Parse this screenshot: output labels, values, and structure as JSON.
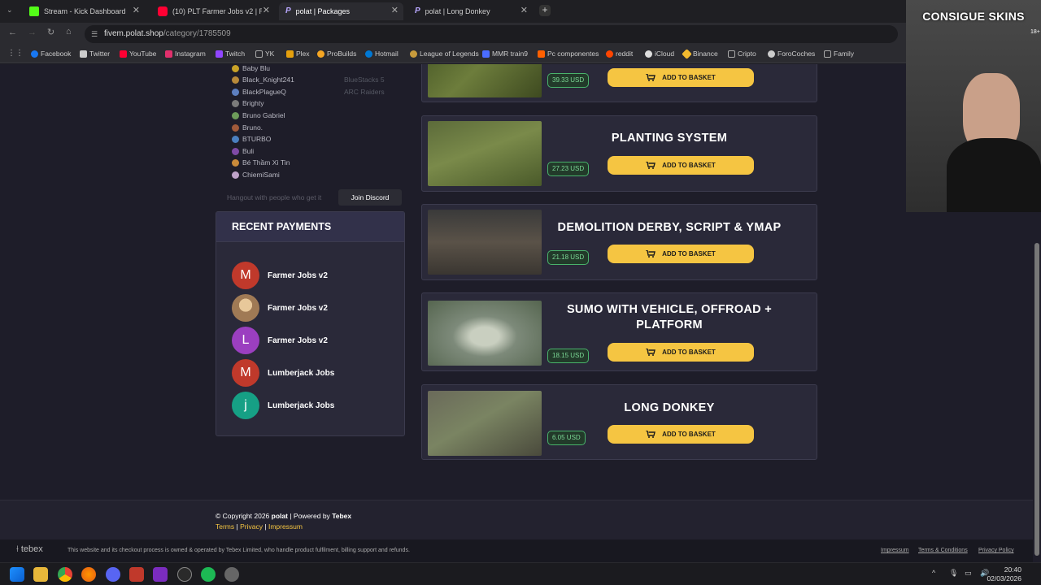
{
  "browser": {
    "tabs": [
      {
        "label": "Stream - Kick Dashboard",
        "color": "#53fc18"
      },
      {
        "label": "(10) PLT Farmer Jobs v2 | Realis",
        "color": "#ff0033"
      },
      {
        "label": "polat | Packages",
        "color": "#7b61ff"
      },
      {
        "label": "polat | Long Donkey",
        "color": "#7b61ff"
      }
    ],
    "url_host": "fivem.polat.shop",
    "url_path": "/category/1785509",
    "bookmarks": [
      {
        "label": "Facebook",
        "color": "#1877f2"
      },
      {
        "label": "Twitter",
        "color": "#cccccc"
      },
      {
        "label": "YouTube",
        "color": "#ff0033"
      },
      {
        "label": "Instagram",
        "color": "#e1306c"
      },
      {
        "label": "Twitch",
        "color": "#9146ff"
      },
      {
        "label": "YK",
        "color": "#888888"
      },
      {
        "label": "Plex",
        "color": "#e5a00d"
      },
      {
        "label": "ProBuilds",
        "color": "#f5a623"
      },
      {
        "label": "Hotmail",
        "color": "#0078d4"
      },
      {
        "label": "League of Legends",
        "color": "#c89b3c"
      },
      {
        "label": "MMR train9",
        "color": "#4a6cff"
      },
      {
        "label": "Pc componentes",
        "color": "#ff6000"
      },
      {
        "label": "reddit",
        "color": "#ff4500"
      },
      {
        "label": "iCloud",
        "color": "#dddddd"
      },
      {
        "label": "Binance",
        "color": "#f3ba2f"
      },
      {
        "label": "Cripto",
        "color": "#888888"
      },
      {
        "label": "ForoCoches",
        "color": "#cccccc"
      },
      {
        "label": "Family",
        "color": "#888888"
      }
    ]
  },
  "discord": {
    "members": [
      {
        "name": "Baby Blu",
        "game": ""
      },
      {
        "name": "Black_Knight241",
        "game": "BlueStacks 5"
      },
      {
        "name": "BlackPlagueQ",
        "game": "ARC Raiders"
      },
      {
        "name": "Brighty",
        "game": ""
      },
      {
        "name": "Bruno Gabriel",
        "game": ""
      },
      {
        "name": "Bruno.",
        "game": ""
      },
      {
        "name": "BTURBO",
        "game": ""
      },
      {
        "name": "Buli",
        "game": ""
      },
      {
        "name": "Bé Thầm Xì Tin",
        "game": ""
      },
      {
        "name": "ChiemiSami",
        "game": ""
      }
    ],
    "footer_text": "Hangout with people who get it",
    "join_label": "Join Discord"
  },
  "recent_payments": {
    "title": "RECENT PAYMENTS",
    "items": [
      {
        "initial": "M",
        "name": "Farmer Jobs v2",
        "color": "#c0392b"
      },
      {
        "initial": "",
        "name": "Farmer Jobs v2",
        "color": "#a07a55"
      },
      {
        "initial": "L",
        "name": "Farmer Jobs v2",
        "color": "#9b3fc0"
      },
      {
        "initial": "M",
        "name": "Lumberjack Jobs",
        "color": "#c0392b"
      },
      {
        "initial": "j",
        "name": "Lumberjack Jobs",
        "color": "#16a085"
      }
    ]
  },
  "packages": [
    {
      "title": "",
      "price": "39.33 USD",
      "button": "ADD TO BASKET"
    },
    {
      "title": "PLANTING SYSTEM",
      "price": "27.23 USD",
      "button": "ADD TO BASKET"
    },
    {
      "title": "DEMOLITION DERBY, SCRIPT & YMAP",
      "price": "21.18 USD",
      "button": "ADD TO BASKET"
    },
    {
      "title": "SUMO WITH VEHICLE, OFFROAD + PLATFORM",
      "price": "18.15 USD",
      "button": "ADD TO BASKET"
    },
    {
      "title": "LONG DONKEY",
      "price": "6.05 USD",
      "button": "ADD TO BASKET"
    }
  ],
  "footer": {
    "copyright_prefix": "© Copyright 2026",
    "brand": "polat",
    "powered_by": "| Powered by",
    "tebex": "Tebex",
    "links": [
      "Terms",
      "Privacy",
      "Impressum"
    ],
    "tebex_logo": "tebex",
    "disclaimer": "This website and its checkout process is owned & operated by Tebex Limited, who handle product fulfilment, billing support and refunds.",
    "right_links": [
      "Impressum",
      "Terms & Conditions",
      "Privacy Policy"
    ]
  },
  "webcam": {
    "overlay_text": "CONSIGUE SKINS",
    "badge": "18+"
  },
  "taskbar": {
    "time": "20:40",
    "date": "02/03/2026"
  }
}
